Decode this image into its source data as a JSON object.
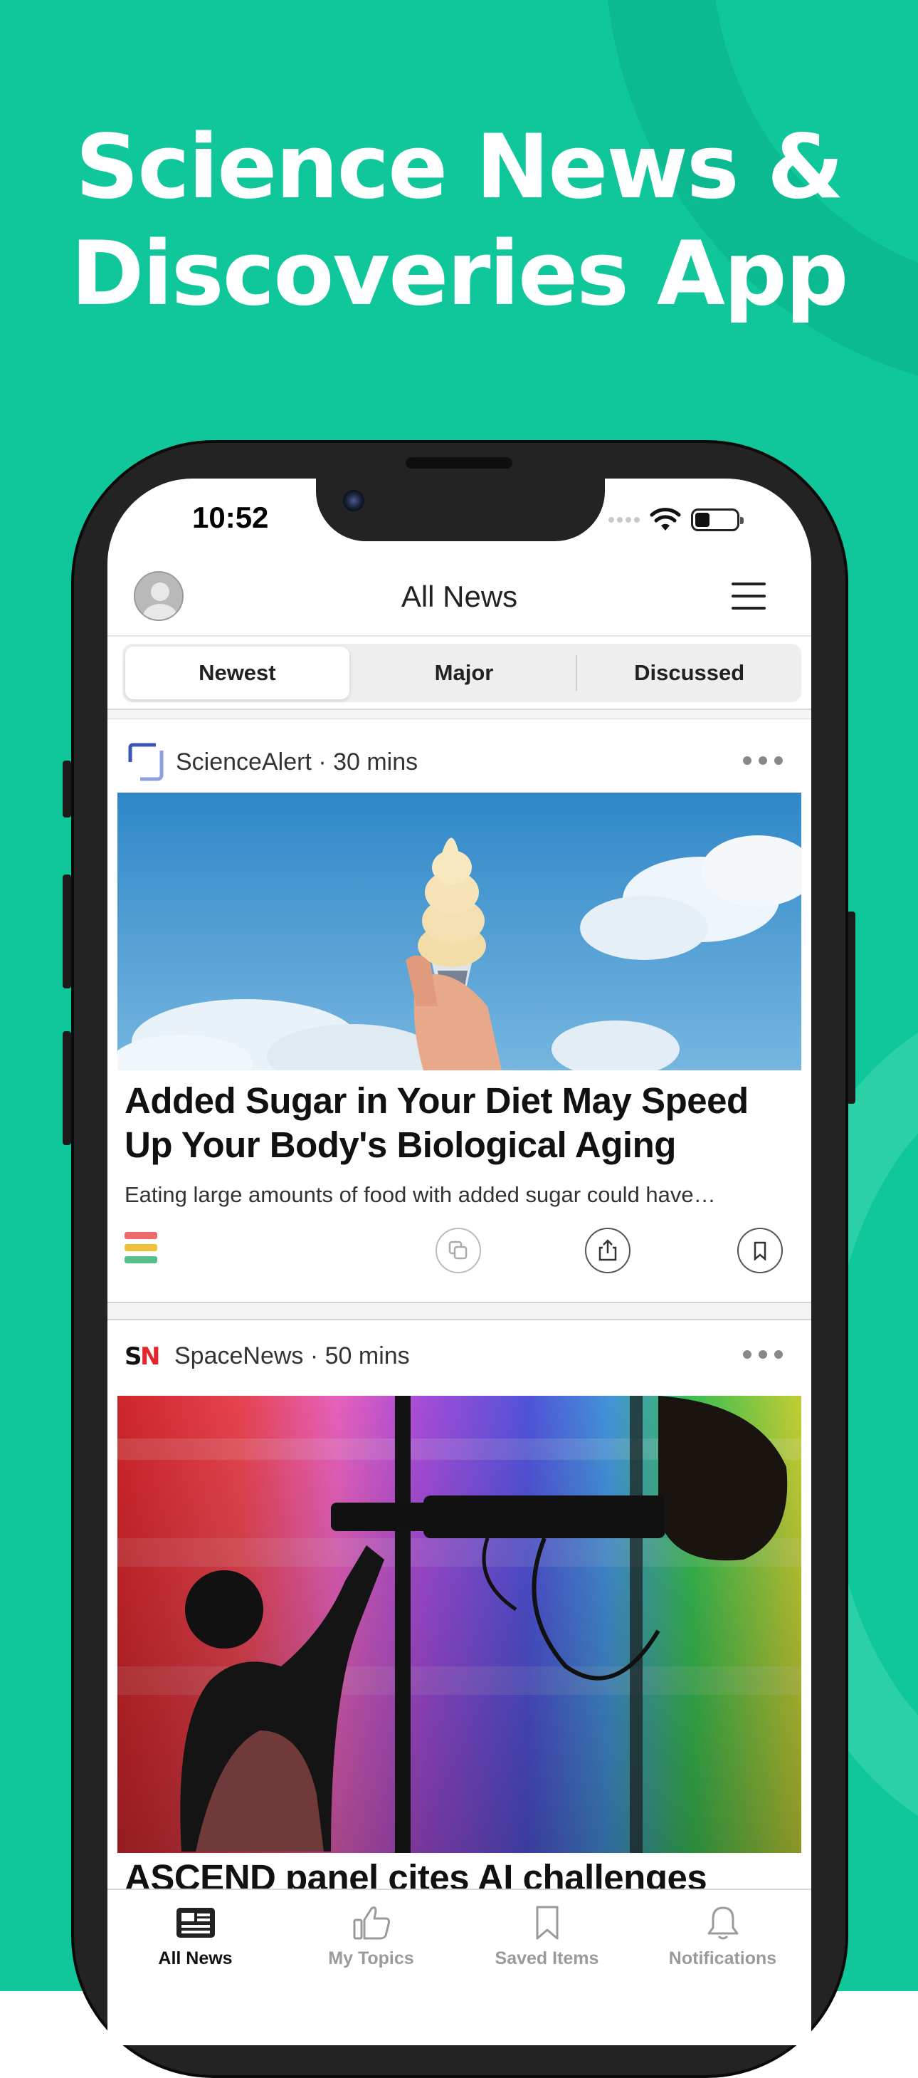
{
  "promo": {
    "headline_line1": "Science News &",
    "headline_line2": "Discoveries App"
  },
  "status_bar": {
    "time": "10:52",
    "battery_level": 0.35
  },
  "header": {
    "title": "All News"
  },
  "segments": [
    {
      "label": "Newest",
      "active": true
    },
    {
      "label": "Major",
      "active": false
    },
    {
      "label": "Discussed",
      "active": false
    }
  ],
  "articles": [
    {
      "source": "ScienceAlert · 30 mins",
      "title_line1": "Added Sugar in Your Diet May Speed",
      "title_line2": "Up Your Body's Biological Aging",
      "description": "Eating large amounts of food with added sugar could have…"
    },
    {
      "source": "SpaceNews · 50 mins",
      "logo_text": "SN",
      "title_line1": "ASCEND panel cites AI challenges"
    }
  ],
  "tabbar": [
    {
      "label": "All News",
      "icon": "newspaper-icon",
      "active": true
    },
    {
      "label": "My Topics",
      "icon": "thumbs-up-icon",
      "active": false
    },
    {
      "label": "Saved Items",
      "icon": "bookmark-icon",
      "active": false
    },
    {
      "label": "Notifications",
      "icon": "bell-icon",
      "active": false
    }
  ],
  "colors": {
    "background": "#0fc79b",
    "phone_frame": "#232323"
  }
}
